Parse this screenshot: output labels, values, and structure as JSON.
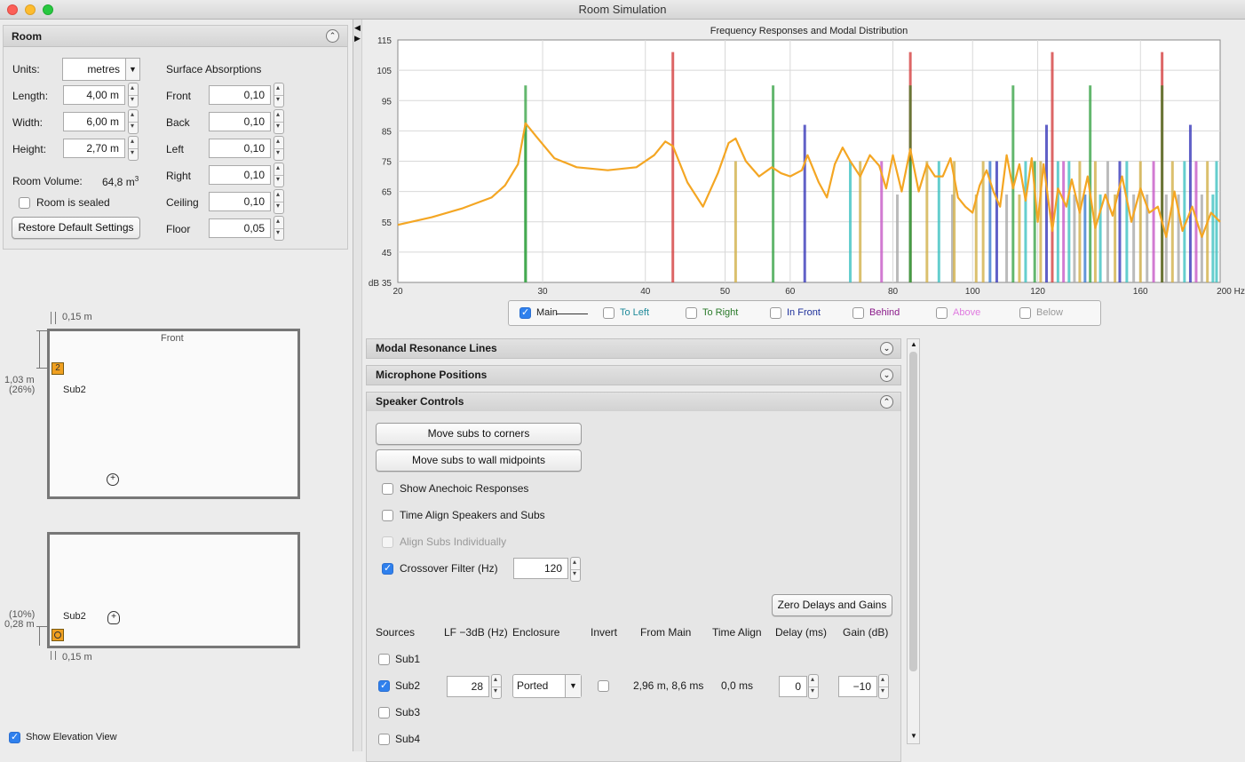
{
  "window": {
    "title": "Room Simulation"
  },
  "room_panel": {
    "title": "Room",
    "units_label": "Units:",
    "units_value": "metres",
    "length_label": "Length:",
    "length_value": "4,00 m",
    "width_label": "Width:",
    "width_value": "6,00 m",
    "height_label": "Height:",
    "height_value": "2,70 m",
    "volume_label": "Room Volume:",
    "volume_value": "64,8 m",
    "volume_sup": "3",
    "sealed_label": "Room is sealed",
    "restore_label": "Restore Default Settings",
    "surface_title": "Surface Absorptions",
    "surfaces": [
      {
        "label": "Front",
        "value": "0,10"
      },
      {
        "label": "Back",
        "value": "0,10"
      },
      {
        "label": "Left",
        "value": "0,10"
      },
      {
        "label": "Right",
        "value": "0,10"
      },
      {
        "label": "Ceiling",
        "value": "0,10"
      },
      {
        "label": "Floor",
        "value": "0,05"
      }
    ]
  },
  "plan_view": {
    "top_dim": "0,15 m",
    "front_label": "Front",
    "side_dim": "1,03 m",
    "side_pct": "(26%)",
    "sub_label": "Sub2",
    "sub_number": "2"
  },
  "elevation_view": {
    "pct": "(10%)",
    "height_dim": "0,28 m",
    "bottom_dim": "0,15 m",
    "sub_label": "Sub2"
  },
  "show_elevation": {
    "label": "Show Elevation View",
    "checked": true
  },
  "chart_data": {
    "type": "line",
    "title": "Frequency Responses and Modal Distribution",
    "x_scale": "log",
    "xlim": [
      20,
      200
    ],
    "ylim": [
      35,
      115
    ],
    "x_ticks": [
      "20",
      "30",
      "40",
      "50",
      "60",
      "80",
      "100",
      "120",
      "160",
      "200 Hz"
    ],
    "x_tick_values": [
      20,
      30,
      40,
      50,
      60,
      80,
      100,
      120,
      160,
      200
    ],
    "y_ticks": [
      "115",
      "105",
      "95",
      "85",
      "75",
      "65",
      "55",
      "45",
      "dB 35"
    ],
    "y_tick_values": [
      115,
      105,
      95,
      85,
      75,
      65,
      55,
      45,
      35
    ],
    "grid": true,
    "main_color": "#f4a623",
    "main_series": {
      "name": "Main",
      "x": [
        20,
        22,
        24,
        26,
        27,
        28,
        28.6,
        29.5,
        31,
        33,
        36,
        39,
        41,
        42.3,
        43.2,
        45,
        47,
        49,
        50.5,
        51.5,
        53,
        55,
        57,
        58.5,
        60,
        62,
        63,
        65,
        66.5,
        68,
        69.5,
        71,
        73,
        75,
        77,
        78.5,
        80,
        82,
        84,
        86,
        88,
        90,
        92,
        94,
        96,
        98,
        100,
        102,
        104,
        106,
        108,
        110,
        112,
        114,
        116,
        118,
        120,
        122,
        125,
        127,
        130,
        132,
        135,
        138,
        141,
        145,
        148,
        152,
        156,
        160,
        164,
        168,
        172,
        176,
        180,
        185,
        190,
        195,
        200
      ],
      "y": [
        54,
        56.5,
        59.5,
        63,
        67,
        74,
        87.5,
        83,
        76,
        73,
        72,
        73,
        77,
        81.5,
        80,
        68,
        60,
        71,
        81,
        82.5,
        75,
        70,
        73,
        71,
        70,
        72,
        77,
        68,
        63,
        74,
        79.5,
        75,
        70,
        77,
        73.5,
        66,
        77,
        65,
        79,
        65,
        74,
        70,
        70,
        76,
        63,
        60,
        58,
        67,
        72,
        65,
        60,
        77,
        66,
        74,
        62,
        76,
        55,
        74,
        52,
        66,
        60,
        69,
        58,
        70,
        53,
        64,
        57,
        70,
        55,
        66,
        58,
        60,
        50,
        65,
        52,
        60,
        50,
        58,
        55
      ]
    },
    "mode_lines": [
      {
        "x": 28.6,
        "top": 100,
        "color": "#3ca54a"
      },
      {
        "x": 28.6,
        "top": 87,
        "color": "#3ca54a"
      },
      {
        "x": 43.2,
        "top": 111,
        "color": "#d44040"
      },
      {
        "x": 51.5,
        "top": 75,
        "color": "#d2b04a"
      },
      {
        "x": 57.2,
        "top": 100,
        "color": "#3ca54a"
      },
      {
        "x": 62.5,
        "top": 87,
        "color": "#3a3aba"
      },
      {
        "x": 71,
        "top": 75,
        "color": "#3fc2c2"
      },
      {
        "x": 73,
        "top": 75,
        "color": "#d2b04a"
      },
      {
        "x": 77.5,
        "top": 75,
        "color": "#c75ac7"
      },
      {
        "x": 81,
        "top": 64,
        "color": "#aaaaaa"
      },
      {
        "x": 84,
        "top": 111,
        "color": "#d44040"
      },
      {
        "x": 84,
        "top": 100,
        "color": "#4b7a2a"
      },
      {
        "x": 84,
        "top": 75,
        "color": "#3ca54a"
      },
      {
        "x": 88,
        "top": 75,
        "color": "#d2b04a"
      },
      {
        "x": 91,
        "top": 75,
        "color": "#3fc2c2"
      },
      {
        "x": 94.5,
        "top": 64,
        "color": "#aaaaaa"
      },
      {
        "x": 95,
        "top": 75,
        "color": "#d2b04a"
      },
      {
        "x": 101,
        "top": 64,
        "color": "#d2b04a"
      },
      {
        "x": 103,
        "top": 75,
        "color": "#d2b04a"
      },
      {
        "x": 105,
        "top": 75,
        "color": "#3a7ad0"
      },
      {
        "x": 107,
        "top": 75,
        "color": "#3a3aba"
      },
      {
        "x": 110,
        "top": 64,
        "color": "#aaaaaa"
      },
      {
        "x": 112,
        "top": 100,
        "color": "#3ca54a"
      },
      {
        "x": 114,
        "top": 64,
        "color": "#d2b04a"
      },
      {
        "x": 116,
        "top": 75,
        "color": "#3fc2c2"
      },
      {
        "x": 119,
        "top": 75,
        "color": "#3ca54a"
      },
      {
        "x": 121,
        "top": 75,
        "color": "#d2b04a"
      },
      {
        "x": 123,
        "top": 87,
        "color": "#3a3aba"
      },
      {
        "x": 125,
        "top": 111,
        "color": "#d44040"
      },
      {
        "x": 127,
        "top": 75,
        "color": "#3fc2c2"
      },
      {
        "x": 129,
        "top": 75,
        "color": "#c75ac7"
      },
      {
        "x": 131,
        "top": 75,
        "color": "#3fc2c2"
      },
      {
        "x": 133,
        "top": 64,
        "color": "#aaaaaa"
      },
      {
        "x": 135,
        "top": 75,
        "color": "#d2b04a"
      },
      {
        "x": 137,
        "top": 64,
        "color": "#3a7ad0"
      },
      {
        "x": 139,
        "top": 100,
        "color": "#3ca54a"
      },
      {
        "x": 141,
        "top": 75,
        "color": "#d2b04a"
      },
      {
        "x": 143,
        "top": 64,
        "color": "#3fc2c2"
      },
      {
        "x": 146,
        "top": 75,
        "color": "#aaaaaa"
      },
      {
        "x": 149,
        "top": 64,
        "color": "#d2b04a"
      },
      {
        "x": 151,
        "top": 75,
        "color": "#3a3aba"
      },
      {
        "x": 154,
        "top": 75,
        "color": "#3fc2c2"
      },
      {
        "x": 157,
        "top": 64,
        "color": "#aaaaaa"
      },
      {
        "x": 160,
        "top": 75,
        "color": "#d2b04a"
      },
      {
        "x": 163,
        "top": 64,
        "color": "#aaaaaa"
      },
      {
        "x": 166,
        "top": 75,
        "color": "#c75ac7"
      },
      {
        "x": 170,
        "top": 111,
        "color": "#d44040"
      },
      {
        "x": 170,
        "top": 100,
        "color": "#4b7a2a"
      },
      {
        "x": 172,
        "top": 64,
        "color": "#aaaaaa"
      },
      {
        "x": 175,
        "top": 75,
        "color": "#d2b04a"
      },
      {
        "x": 178,
        "top": 64,
        "color": "#aaaaaa"
      },
      {
        "x": 181,
        "top": 75,
        "color": "#3fc2c2"
      },
      {
        "x": 184,
        "top": 87,
        "color": "#3a3aba"
      },
      {
        "x": 187,
        "top": 75,
        "color": "#c75ac7"
      },
      {
        "x": 190,
        "top": 64,
        "color": "#aaaaaa"
      },
      {
        "x": 193,
        "top": 75,
        "color": "#d2b04a"
      },
      {
        "x": 196,
        "top": 64,
        "color": "#3fc2c2"
      },
      {
        "x": 198,
        "top": 75,
        "color": "#3fc2c2"
      }
    ]
  },
  "legend": [
    {
      "label": "Main",
      "color": "#1a1a1a",
      "checked": true
    },
    {
      "label": "To Left",
      "color": "#1f8a9a",
      "checked": false
    },
    {
      "label": "To Right",
      "color": "#2a7a2a",
      "checked": false
    },
    {
      "label": "In Front",
      "color": "#1d2f9a",
      "checked": false
    },
    {
      "label": "Behind",
      "color": "#8a1a8a",
      "checked": false
    },
    {
      "label": "Above",
      "color": "#e07ae0",
      "checked": false
    },
    {
      "label": "Below",
      "color": "#999999",
      "checked": false
    }
  ],
  "sections": {
    "modal": "Modal Resonance Lines",
    "mic": "Microphone Positions",
    "speaker": "Speaker Controls"
  },
  "speaker_controls": {
    "move_corners": "Move subs to corners",
    "move_midpoints": "Move subs to wall midpoints",
    "anechoic": "Show Anechoic Responses",
    "time_align": "Time Align Speakers and Subs",
    "align_subs": "Align Subs Individually",
    "crossover": "Crossover Filter (Hz)",
    "crossover_value": "120",
    "zero_button": "Zero Delays and Gains",
    "headers": [
      "Sources",
      "LF −3dB (Hz)",
      "Enclosure",
      "Invert",
      "From Main",
      "Time Align",
      "Delay (ms)",
      "Gain (dB)"
    ],
    "sources": [
      {
        "name": "Sub1",
        "checked": false
      },
      {
        "name": "Sub2",
        "checked": true,
        "lf": "28",
        "enclosure": "Ported",
        "from_main": "2,96 m, 8,6 ms",
        "time_align": "0,0 ms",
        "delay": "0",
        "gain": "−10"
      },
      {
        "name": "Sub3",
        "checked": false
      },
      {
        "name": "Sub4",
        "checked": false
      }
    ]
  }
}
